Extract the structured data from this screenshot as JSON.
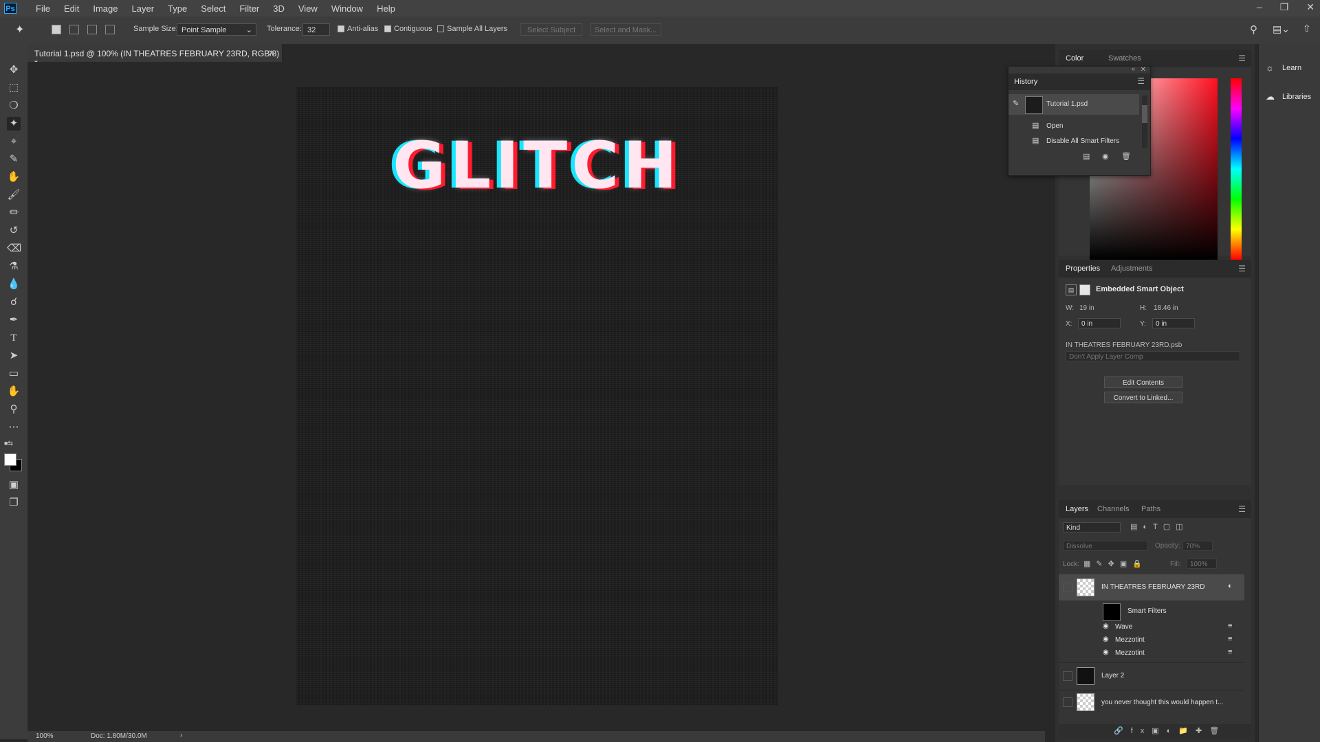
{
  "app": {
    "logo": "Ps",
    "menu": [
      "File",
      "Edit",
      "Image",
      "Layer",
      "Type",
      "Select",
      "Filter",
      "3D",
      "View",
      "Window",
      "Help"
    ]
  },
  "options": {
    "sample_size_label": "Sample Size:",
    "sample_size_value": "Point Sample",
    "tolerance_label": "Tolerance:",
    "tolerance_value": "32",
    "anti_alias": "Anti-alias",
    "contiguous": "Contiguous",
    "sample_all_layers": "Sample All Layers",
    "select_subject": "Select Subject",
    "select_and_mask": "Select and Mask..."
  },
  "document": {
    "tab_title": "Tutorial 1.psd @ 100% (IN THEATRES FEBRUARY 23RD, RGB/8) *",
    "canvas_text": "GLITCH",
    "zoom": "100%",
    "doc_info": "Doc: 1.80M/30.0M"
  },
  "color_panel": {
    "tabs": [
      "Color",
      "Swatches"
    ]
  },
  "history": {
    "title": "History",
    "snapshot": "Tutorial 1.psd",
    "items": [
      "Open",
      "Disable All Smart Filters"
    ]
  },
  "side": {
    "learn": "Learn",
    "libraries": "Libraries"
  },
  "properties": {
    "tabs": [
      "Properties",
      "Adjustments"
    ],
    "type_label": "Embedded Smart Object",
    "w_label": "W:",
    "w_value": "19 in",
    "h_label": "H:",
    "h_value": "18.46 in",
    "x_label": "X:",
    "x_value": "0 in",
    "y_label": "Y:",
    "y_value": "0 in",
    "file_name": "IN THEATRES FEBRUARY 23RD.psb",
    "layer_comp": "Don't Apply Layer Comp",
    "edit_contents": "Edit Contents",
    "convert_linked": "Convert to Linked..."
  },
  "layers": {
    "tabs": [
      "Layers",
      "Channels",
      "Paths"
    ],
    "kind": "Kind",
    "blend_mode": "Dissolve",
    "opacity_label": "Opacity:",
    "opacity_value": "70%",
    "lock_label": "Lock:",
    "fill_label": "Fill:",
    "fill_value": "100%",
    "rows": [
      {
        "name": "IN THEATRES FEBRUARY 23RD"
      },
      {
        "name": "Smart Filters"
      },
      {
        "name": "Wave"
      },
      {
        "name": "Mezzotint"
      },
      {
        "name": "Mezzotint"
      },
      {
        "name": "Layer 2"
      },
      {
        "name": "you never thought this would happen t..."
      }
    ]
  }
}
